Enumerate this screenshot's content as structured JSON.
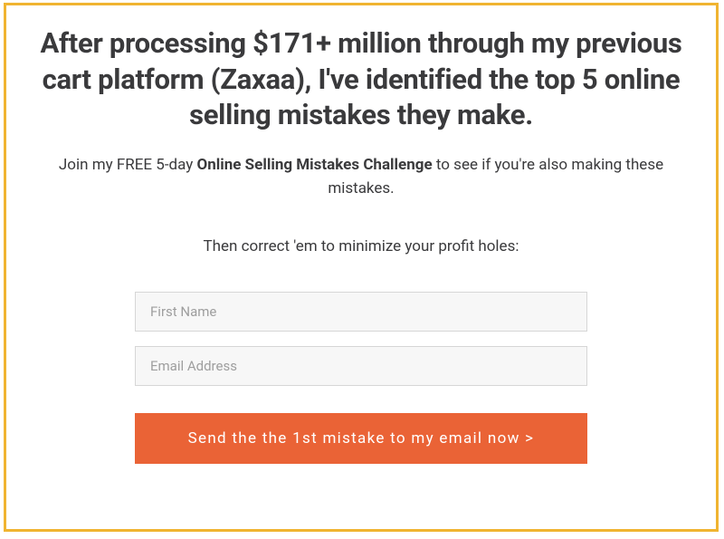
{
  "headline": "After processing $171+ million through my previous cart platform (Zaxaa), I've identified the top 5 online selling mistakes they make.",
  "subhead": {
    "prefix": "Join my FREE 5-day ",
    "bold": "Online Selling Mistakes Challenge",
    "suffix": " to see if you're also making these mistakes."
  },
  "followup": "Then correct 'em to minimize your profit holes:",
  "form": {
    "first_name_placeholder": "First Name",
    "email_placeholder": "Email Address",
    "submit_label": "Send the the 1st mistake to my email now >"
  },
  "colors": {
    "border": "#f0b431",
    "button": "#ea6336",
    "text": "#3a3a3c"
  }
}
